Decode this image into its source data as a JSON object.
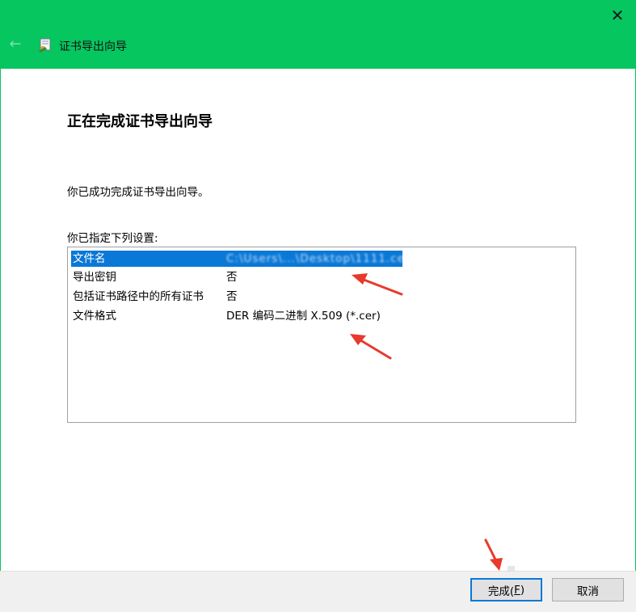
{
  "window": {
    "title": "证书导出向导",
    "back_glyph": "←",
    "close_glyph": "✕",
    "accent": "#06c65f"
  },
  "page": {
    "heading": "正在完成证书导出向导",
    "success_text": "你已成功完成证书导出向导。",
    "settings_label": "你已指定下列设置:"
  },
  "settings": [
    {
      "key": "文件名",
      "value": "C:\\Users\\...\\Desktop\\1111.cer"
    },
    {
      "key": "导出密钥",
      "value": "否"
    },
    {
      "key": "包括证书路径中的所有证书",
      "value": "否"
    },
    {
      "key": "文件格式",
      "value": "DER 编码二进制 X.509 (*.cer)"
    }
  ],
  "buttons": {
    "finish_text": "完成(",
    "finish_mnemonic": "F",
    "finish_close": ")",
    "cancel": "取消"
  },
  "annotations": {
    "arrow_color": "#e8392c"
  },
  "colors": {
    "selection": "#0a78d7",
    "footer_bg": "#f0f0f0"
  }
}
